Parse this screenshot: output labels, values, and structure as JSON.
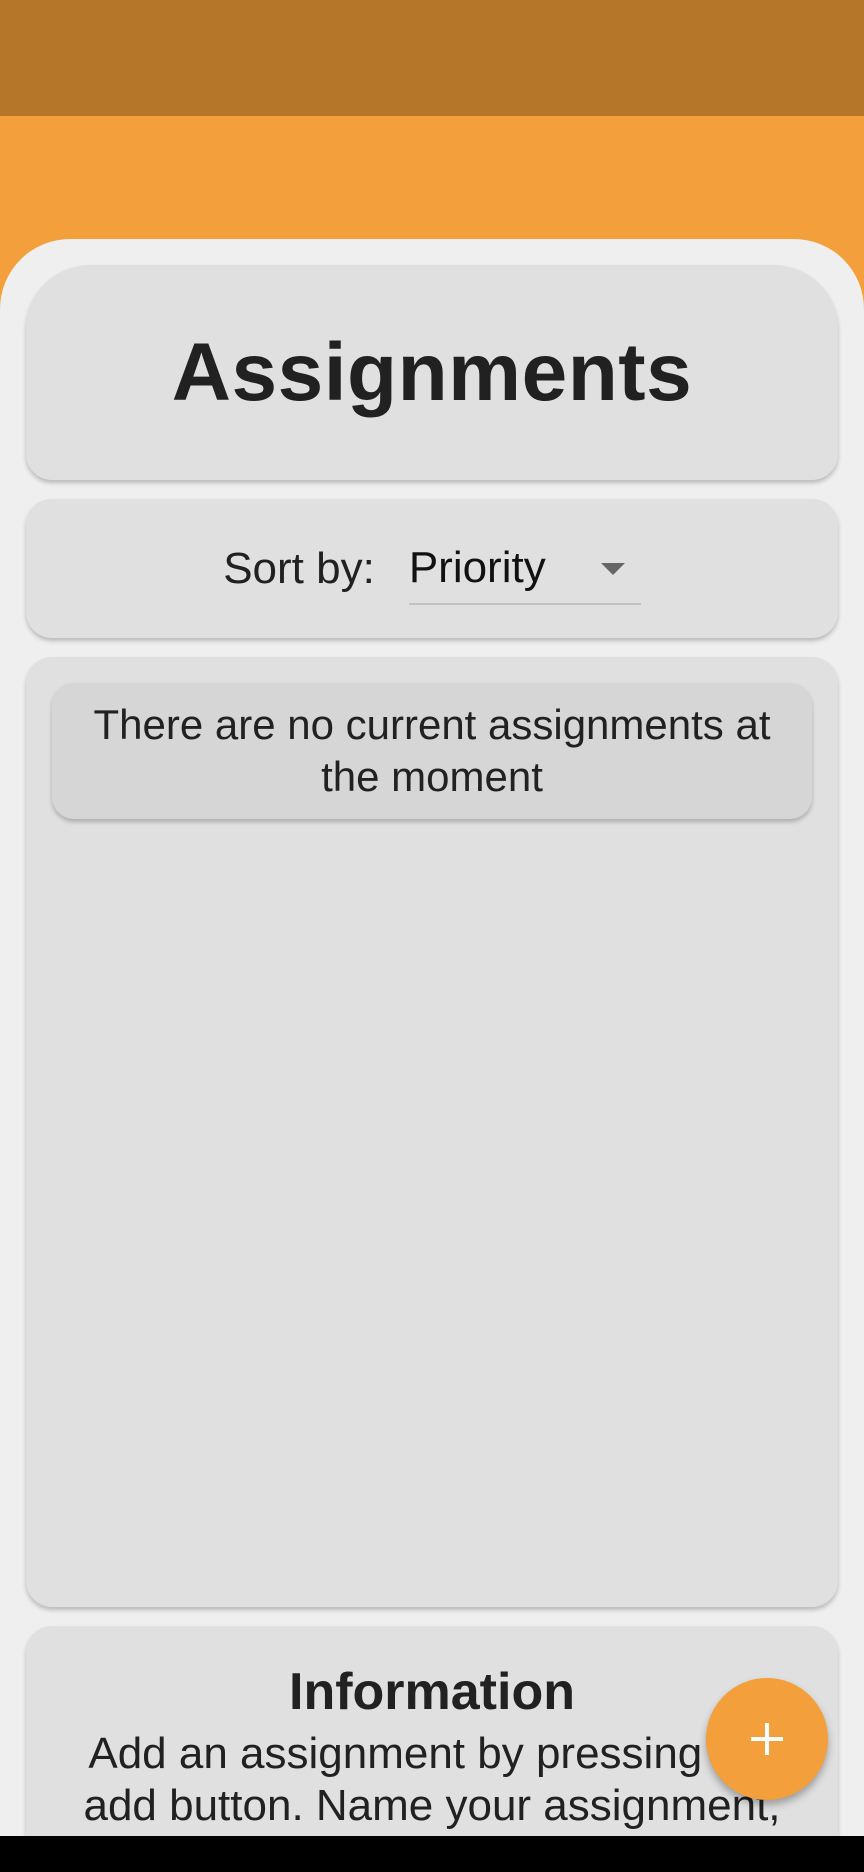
{
  "header": {
    "title": "Assignments"
  },
  "sort": {
    "label": "Sort by:",
    "selected": "Priority"
  },
  "assignments": {
    "empty_message": "There are no current assignments at the moment"
  },
  "info": {
    "title": "Information",
    "text": "Add an assignment by pressing the add button. Name your assignment, choose the subject, due date and priority"
  },
  "fab": {
    "icon": "plus-icon"
  },
  "colors": {
    "status_bar": "#B5762A",
    "accent": "#F39F3B",
    "card": "#E0E0E0",
    "background": "#EFEFEF"
  }
}
